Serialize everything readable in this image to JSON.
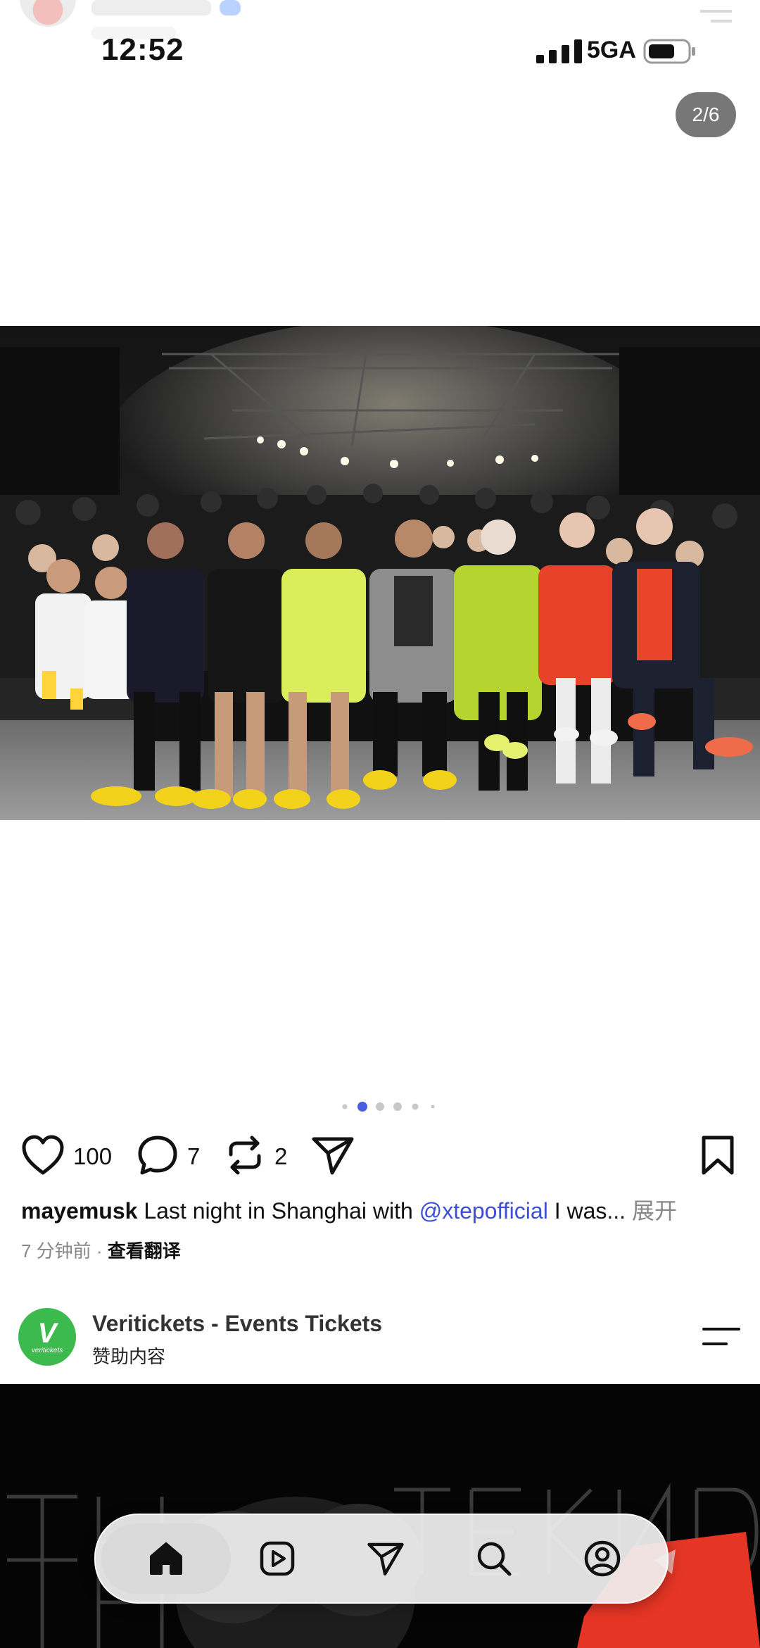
{
  "status": {
    "time": "12:52",
    "network": "5GA"
  },
  "post": {
    "image_counter": "2/6",
    "carousel": {
      "total": 6,
      "active_index": 1
    },
    "likes": "100",
    "comments": "7",
    "reposts": "2",
    "caption": {
      "username": "mayemusk",
      "text_before": " Last night in Shanghai with ",
      "mention": "@xtepofficial",
      "text_after": " I was... ",
      "more": "展开"
    },
    "time_ago": "7 分钟前",
    "separator": " · ",
    "translate_label": "查看翻译"
  },
  "sponsored": {
    "logo_letter": "V",
    "logo_word": "veritickets",
    "name": "Veritickets - Events Tickets",
    "label": "赞助内容"
  },
  "nav": {
    "items": [
      "home-icon",
      "reels-icon",
      "send-icon",
      "search-icon",
      "profile-icon"
    ],
    "active": "home-icon"
  },
  "colors": {
    "accent": "#3d4fd6",
    "active_dot": "#4a5ce0",
    "sponsor_green": "#3cba4e"
  }
}
